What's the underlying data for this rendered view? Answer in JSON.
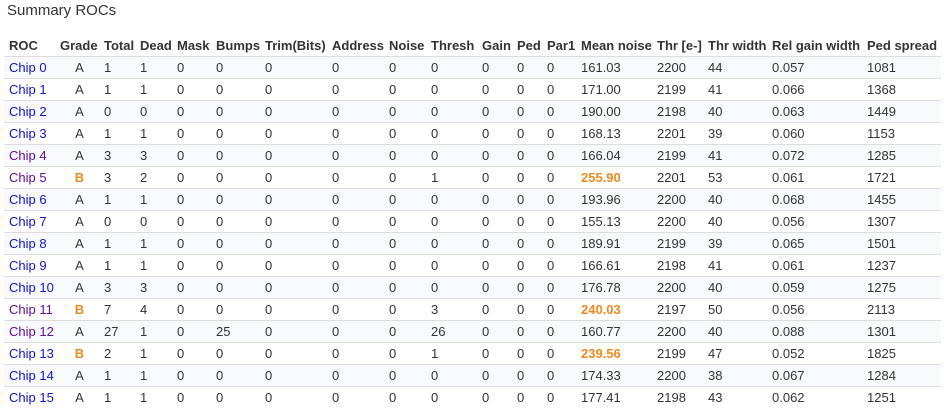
{
  "title": "Summary ROCs",
  "columns": [
    "ROC",
    "Grade",
    "Total",
    "Dead",
    "Mask",
    "Bumps",
    "Trim(Bits)",
    "Address",
    "Noise",
    "Thresh",
    "Gain",
    "Ped",
    "Par1",
    "Mean noise",
    "Thr [e-]",
    "Thr width",
    "Rel gain width",
    "Ped spread"
  ],
  "accent_colors": {
    "link": "#1111cc",
    "visited_link": "#660e96",
    "warning": "#f0881f"
  },
  "rows": [
    {
      "roc": "Chip 0",
      "visited": false,
      "grade": "A",
      "total": "1",
      "dead": "1",
      "mask": "0",
      "bumps": "0",
      "trim": "0",
      "address": "0",
      "noise": "0",
      "thresh": "0",
      "gain": "0",
      "ped": "0",
      "par1": "0",
      "mean_noise": "161.03",
      "thr": "2200",
      "thr_width": "44",
      "rel_gain_width": "0.057",
      "ped_spread": "1081"
    },
    {
      "roc": "Chip 1",
      "visited": false,
      "grade": "A",
      "total": "1",
      "dead": "1",
      "mask": "0",
      "bumps": "0",
      "trim": "0",
      "address": "0",
      "noise": "0",
      "thresh": "0",
      "gain": "0",
      "ped": "0",
      "par1": "0",
      "mean_noise": "171.00",
      "thr": "2199",
      "thr_width": "41",
      "rel_gain_width": "0.066",
      "ped_spread": "1368"
    },
    {
      "roc": "Chip 2",
      "visited": false,
      "grade": "A",
      "total": "0",
      "dead": "0",
      "mask": "0",
      "bumps": "0",
      "trim": "0",
      "address": "0",
      "noise": "0",
      "thresh": "0",
      "gain": "0",
      "ped": "0",
      "par1": "0",
      "mean_noise": "190.00",
      "thr": "2198",
      "thr_width": "40",
      "rel_gain_width": "0.063",
      "ped_spread": "1449"
    },
    {
      "roc": "Chip 3",
      "visited": false,
      "grade": "A",
      "total": "1",
      "dead": "1",
      "mask": "0",
      "bumps": "0",
      "trim": "0",
      "address": "0",
      "noise": "0",
      "thresh": "0",
      "gain": "0",
      "ped": "0",
      "par1": "0",
      "mean_noise": "168.13",
      "thr": "2201",
      "thr_width": "39",
      "rel_gain_width": "0.060",
      "ped_spread": "1153"
    },
    {
      "roc": "Chip 4",
      "visited": true,
      "grade": "A",
      "total": "3",
      "dead": "3",
      "mask": "0",
      "bumps": "0",
      "trim": "0",
      "address": "0",
      "noise": "0",
      "thresh": "0",
      "gain": "0",
      "ped": "0",
      "par1": "0",
      "mean_noise": "166.04",
      "thr": "2199",
      "thr_width": "41",
      "rel_gain_width": "0.072",
      "ped_spread": "1285"
    },
    {
      "roc": "Chip 5",
      "visited": true,
      "grade": "B",
      "total": "3",
      "dead": "2",
      "mask": "0",
      "bumps": "0",
      "trim": "0",
      "address": "0",
      "noise": "0",
      "thresh": "1",
      "gain": "0",
      "ped": "0",
      "par1": "0",
      "mean_noise": "255.90",
      "noise_high": true,
      "thr": "2201",
      "thr_width": "53",
      "rel_gain_width": "0.061",
      "ped_spread": "1721"
    },
    {
      "roc": "Chip 6",
      "visited": false,
      "grade": "A",
      "total": "1",
      "dead": "1",
      "mask": "0",
      "bumps": "0",
      "trim": "0",
      "address": "0",
      "noise": "0",
      "thresh": "0",
      "gain": "0",
      "ped": "0",
      "par1": "0",
      "mean_noise": "193.96",
      "thr": "2200",
      "thr_width": "40",
      "rel_gain_width": "0.068",
      "ped_spread": "1455"
    },
    {
      "roc": "Chip 7",
      "visited": false,
      "grade": "A",
      "total": "0",
      "dead": "0",
      "mask": "0",
      "bumps": "0",
      "trim": "0",
      "address": "0",
      "noise": "0",
      "thresh": "0",
      "gain": "0",
      "ped": "0",
      "par1": "0",
      "mean_noise": "155.13",
      "thr": "2200",
      "thr_width": "40",
      "rel_gain_width": "0.056",
      "ped_spread": "1307"
    },
    {
      "roc": "Chip 8",
      "visited": false,
      "grade": "A",
      "total": "1",
      "dead": "1",
      "mask": "0",
      "bumps": "0",
      "trim": "0",
      "address": "0",
      "noise": "0",
      "thresh": "0",
      "gain": "0",
      "ped": "0",
      "par1": "0",
      "mean_noise": "189.91",
      "thr": "2199",
      "thr_width": "39",
      "rel_gain_width": "0.065",
      "ped_spread": "1501"
    },
    {
      "roc": "Chip 9",
      "visited": false,
      "grade": "A",
      "total": "1",
      "dead": "1",
      "mask": "0",
      "bumps": "0",
      "trim": "0",
      "address": "0",
      "noise": "0",
      "thresh": "0",
      "gain": "0",
      "ped": "0",
      "par1": "0",
      "mean_noise": "166.61",
      "thr": "2198",
      "thr_width": "41",
      "rel_gain_width": "0.061",
      "ped_spread": "1237"
    },
    {
      "roc": "Chip 10",
      "visited": false,
      "grade": "A",
      "total": "3",
      "dead": "3",
      "mask": "0",
      "bumps": "0",
      "trim": "0",
      "address": "0",
      "noise": "0",
      "thresh": "0",
      "gain": "0",
      "ped": "0",
      "par1": "0",
      "mean_noise": "176.78",
      "thr": "2200",
      "thr_width": "40",
      "rel_gain_width": "0.059",
      "ped_spread": "1275"
    },
    {
      "roc": "Chip 11",
      "visited": true,
      "grade": "B",
      "total": "7",
      "dead": "4",
      "mask": "0",
      "bumps": "0",
      "trim": "0",
      "address": "0",
      "noise": "0",
      "thresh": "3",
      "gain": "0",
      "ped": "0",
      "par1": "0",
      "mean_noise": "240.03",
      "noise_high": true,
      "thr": "2197",
      "thr_width": "50",
      "rel_gain_width": "0.056",
      "ped_spread": "2113"
    },
    {
      "roc": "Chip 12",
      "visited": true,
      "grade": "A",
      "total": "27",
      "dead": "1",
      "mask": "0",
      "bumps": "25",
      "trim": "0",
      "address": "0",
      "noise": "0",
      "thresh": "26",
      "gain": "0",
      "ped": "0",
      "par1": "0",
      "mean_noise": "160.77",
      "thr": "2200",
      "thr_width": "40",
      "rel_gain_width": "0.088",
      "ped_spread": "1301"
    },
    {
      "roc": "Chip 13",
      "visited": false,
      "grade": "B",
      "total": "2",
      "dead": "1",
      "mask": "0",
      "bumps": "0",
      "trim": "0",
      "address": "0",
      "noise": "0",
      "thresh": "1",
      "gain": "0",
      "ped": "0",
      "par1": "0",
      "mean_noise": "239.56",
      "noise_high": true,
      "thr": "2199",
      "thr_width": "47",
      "rel_gain_width": "0.052",
      "ped_spread": "1825"
    },
    {
      "roc": "Chip 14",
      "visited": false,
      "grade": "A",
      "total": "1",
      "dead": "1",
      "mask": "0",
      "bumps": "0",
      "trim": "0",
      "address": "0",
      "noise": "0",
      "thresh": "0",
      "gain": "0",
      "ped": "0",
      "par1": "0",
      "mean_noise": "174.33",
      "thr": "2200",
      "thr_width": "38",
      "rel_gain_width": "0.067",
      "ped_spread": "1284"
    },
    {
      "roc": "Chip 15",
      "visited": false,
      "grade": "A",
      "total": "1",
      "dead": "1",
      "mask": "0",
      "bumps": "0",
      "trim": "0",
      "address": "0",
      "noise": "0",
      "thresh": "0",
      "gain": "0",
      "ped": "0",
      "par1": "0",
      "mean_noise": "177.41",
      "thr": "2198",
      "thr_width": "43",
      "rel_gain_width": "0.062",
      "ped_spread": "1251"
    }
  ]
}
